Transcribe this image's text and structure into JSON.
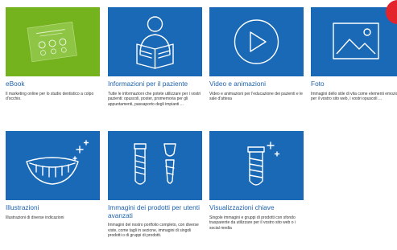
{
  "cards": [
    {
      "title": "eBook",
      "description": "Il marketing online per lo studio dentistico a colpo d'occhio.",
      "icon": "ebook-cover-icon",
      "bg_color": "#74b21e"
    },
    {
      "title": "Informazioni per il paziente",
      "description": "Tutte le informazioni che potete utilizzare per i vostri pazienti: opuscoli, poster, promemoria per gli appuntamenti, passaporto degli impianti ...",
      "icon": "person-reading-icon",
      "bg_color": "#1a69b6"
    },
    {
      "title": "Video e animazioni",
      "description": "Video e animazioni per l'educazione dei pazienti e le sale d'attesa",
      "icon": "play-icon",
      "bg_color": "#1a69b6"
    },
    {
      "title": "Foto",
      "description": "Immagini dello stile di vita come elementi emozionali per il vostro sito web, i vostri opuscoli ...",
      "icon": "image-icon",
      "bg_color": "#1a69b6"
    },
    {
      "title": "Illustrazioni",
      "description": "Illustrazioni di diverse indicazioni",
      "icon": "smile-teeth-icon",
      "bg_color": "#1a69b6"
    },
    {
      "title": "Immagini dei prodotti per utenti avanzati",
      "description": "Immagini del nostro portfolio completo, con diverse viste, come tagli in sezione, immagini di singoli prodotti o di gruppi di prodotti.",
      "icon": "implants-icon",
      "bg_color": "#1a69b6"
    },
    {
      "title": "Visualizzazioni chiave",
      "description": "Singole immagini e gruppi di prodotti con sfondo trasparente da utilizzare per il vostro sito web o i social media",
      "icon": "implant-sparkle-icon",
      "bg_color": "#1a69b6"
    }
  ],
  "accent_color": "#e3242b"
}
